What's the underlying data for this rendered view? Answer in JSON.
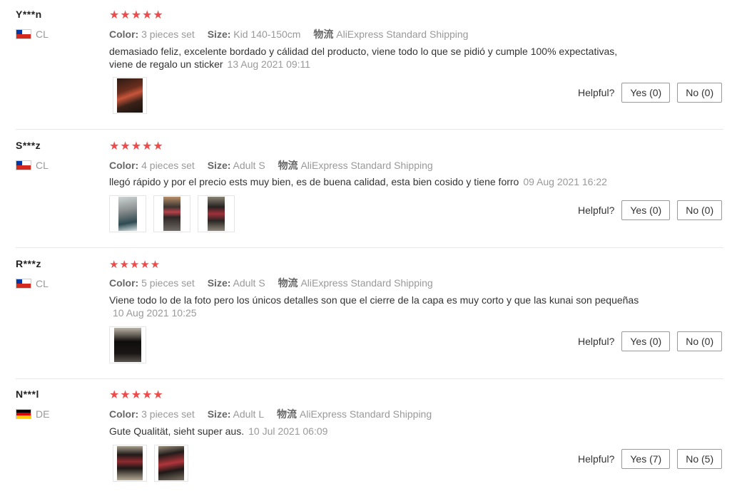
{
  "labels": {
    "color_key": "Color:",
    "size_key": "Size:",
    "shipping_key": "物流",
    "helpful": "Helpful?"
  },
  "reviews": [
    {
      "user": "Y***n",
      "country": "CL",
      "stars": "★★★★★",
      "color": "3 pieces set",
      "size": "Kid 140-150cm",
      "shipping": "AliExpress Standard Shipping",
      "text_line1": "demasiado feliz, excelente bordado y cálidad del producto, viene todo lo que se pidió y cumple 100% expectativas,",
      "text_line2": "viene de regalo un sticker",
      "date": "13 Aug 2021 09:11",
      "yes": "Yes (0)",
      "no": "No (0)"
    },
    {
      "user": "S***z",
      "country": "CL",
      "stars": "★★★★★",
      "color": "4 pieces set",
      "size": "Adult S",
      "shipping": "AliExpress Standard Shipping",
      "text_line1": "llegó rápido y por el precio ests muy bien, es de buena calidad, esta bien cosido y tiene forro",
      "text_line2": "",
      "date": "09 Aug 2021 16:22",
      "yes": "Yes (0)",
      "no": "No (0)"
    },
    {
      "user": "R***z",
      "country": "CL",
      "stars": "★★★★★",
      "color": "5 pieces set",
      "size": "Adult S",
      "shipping": "AliExpress Standard Shipping",
      "text_line1": "Viene todo lo de la foto pero los únicos detalles son que el cierre de la capa es muy corto y que las kunai son pequeñas",
      "text_line2": "",
      "date": "10 Aug 2021 10:25",
      "yes": "Yes (0)",
      "no": "No (0)"
    },
    {
      "user": "N***l",
      "country": "DE",
      "stars": "★★★★★",
      "color": "3 pieces set",
      "size": "Adult L",
      "shipping": "AliExpress Standard Shipping",
      "text_line1": "Gute Qualität, sieht super aus.",
      "text_line2": "",
      "date": "10 Jul 2021 06:09",
      "yes": "Yes (7)",
      "no": "No (5)"
    }
  ],
  "colors": {
    "star": "#f04b4b",
    "muted": "#999999",
    "separator": "#e8e8e8"
  }
}
